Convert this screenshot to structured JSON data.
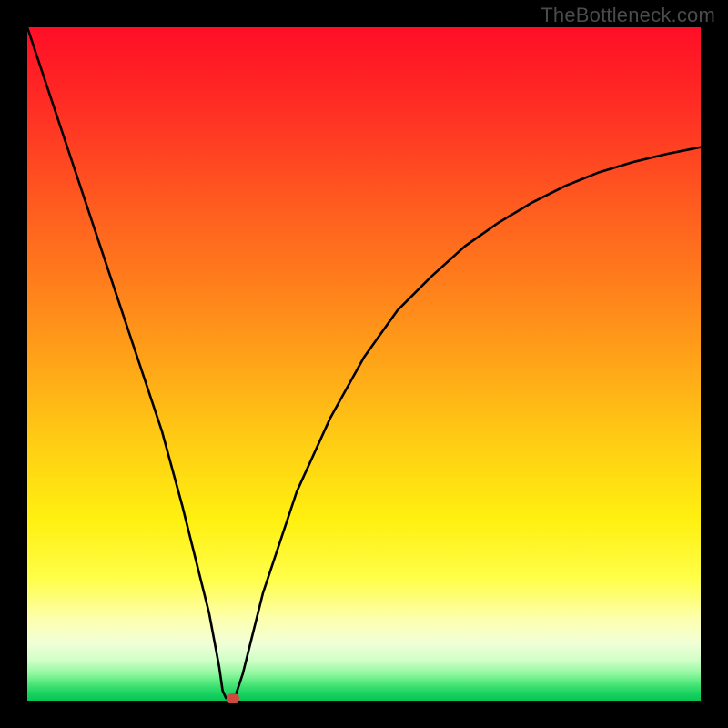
{
  "watermark": "TheBottleneck.com",
  "chart_data": {
    "type": "line",
    "title": "",
    "xlabel": "",
    "ylabel": "",
    "xlim": [
      0,
      100
    ],
    "ylim": [
      0,
      100
    ],
    "series": [
      {
        "name": "bottleneck-curve",
        "x": [
          0,
          5,
          10,
          15,
          20,
          23,
          25,
          27,
          28.5,
          29.0,
          29.5,
          30,
          30.5,
          31,
          32,
          33,
          35,
          40,
          45,
          50,
          55,
          60,
          65,
          70,
          75,
          80,
          85,
          90,
          95,
          100
        ],
        "values": [
          100,
          85,
          70,
          55,
          40,
          29,
          21,
          13,
          5,
          1.5,
          0.4,
          0.3,
          0.4,
          1.0,
          4,
          8,
          16,
          31,
          42,
          51,
          58,
          63,
          67.5,
          71,
          74,
          76.5,
          78.5,
          80,
          81.2,
          82.2
        ]
      }
    ],
    "marker": {
      "x": 30.5,
      "y": 0.3,
      "color": "#cf4a3e"
    },
    "gradient_stops": [
      {
        "offset": 0.0,
        "color": "#ff0e26"
      },
      {
        "offset": 0.12,
        "color": "#ff2e24"
      },
      {
        "offset": 0.25,
        "color": "#ff5720"
      },
      {
        "offset": 0.38,
        "color": "#ff7e1c"
      },
      {
        "offset": 0.5,
        "color": "#ffa518"
      },
      {
        "offset": 0.62,
        "color": "#ffce14"
      },
      {
        "offset": 0.73,
        "color": "#fff010"
      },
      {
        "offset": 0.82,
        "color": "#fffe4a"
      },
      {
        "offset": 0.88,
        "color": "#fdffb0"
      },
      {
        "offset": 0.915,
        "color": "#f0ffd6"
      },
      {
        "offset": 0.94,
        "color": "#d0ffc8"
      },
      {
        "offset": 0.96,
        "color": "#90f8a0"
      },
      {
        "offset": 0.975,
        "color": "#4ce678"
      },
      {
        "offset": 0.99,
        "color": "#17d15f"
      },
      {
        "offset": 1.0,
        "color": "#07c554"
      }
    ]
  }
}
